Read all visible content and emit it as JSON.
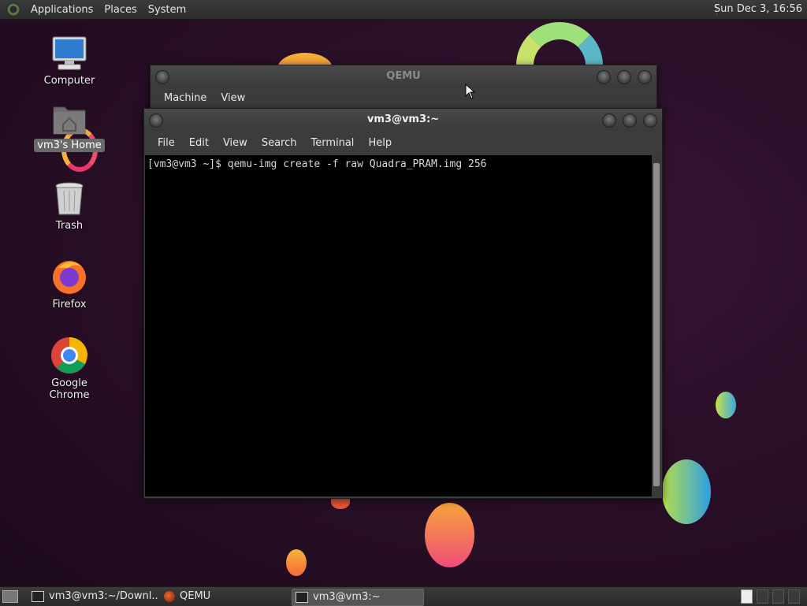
{
  "top_panel": {
    "menu": [
      "Applications",
      "Places",
      "System"
    ],
    "clock": "Sun Dec 3, 16:56"
  },
  "desktop": {
    "icons": [
      {
        "label": "Computer",
        "icon": "computer-icon"
      },
      {
        "label": "vm3's Home",
        "icon": "home-folder-icon",
        "selected": true
      },
      {
        "label": "Trash",
        "icon": "trash-icon"
      },
      {
        "label": "Firefox",
        "icon": "firefox-icon"
      },
      {
        "label": "Google Chrome",
        "icon": "chrome-icon"
      }
    ]
  },
  "qemu_window": {
    "title": "QEMU",
    "menu": [
      "Machine",
      "View"
    ]
  },
  "terminal_window": {
    "title": "vm3@vm3:~",
    "menu": [
      "File",
      "Edit",
      "View",
      "Search",
      "Terminal",
      "Help"
    ],
    "prompt": "[vm3@vm3 ~]$ ",
    "command": "qemu-img create -f raw Quadra_PRAM.img 256"
  },
  "taskbar": {
    "items": [
      {
        "label": "vm3@vm3:~/Downl...",
        "icon": "terminal-icon"
      },
      {
        "label": "QEMU",
        "icon": "qemu-icon"
      },
      {
        "label": "vm3@vm3:~",
        "icon": "terminal-icon",
        "active": true
      }
    ]
  },
  "colors": {
    "accent": "#6e8a53",
    "terminal_bg": "#000000",
    "panel_bg": "#2c2c2c"
  }
}
